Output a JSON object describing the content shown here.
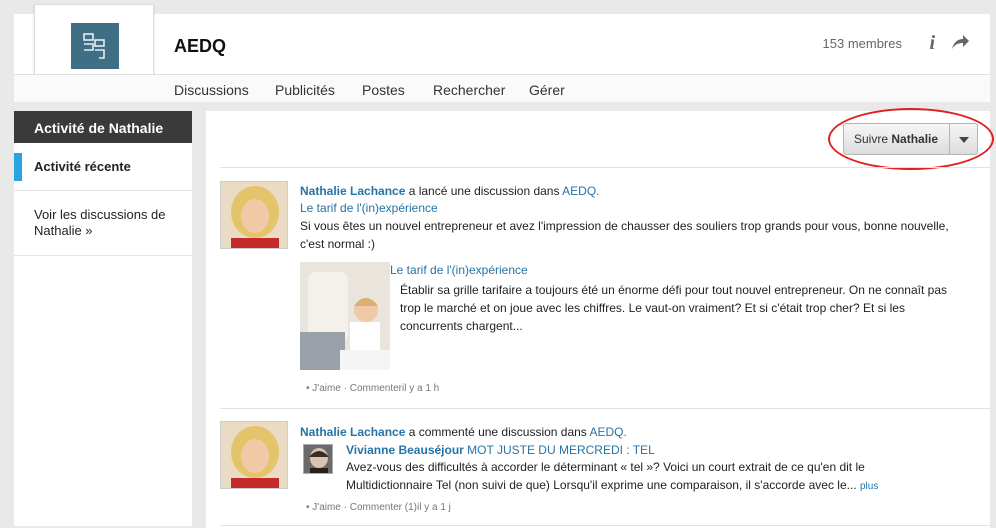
{
  "header": {
    "group_name": "AEDQ",
    "members": "153 membres",
    "info_glyph": "i"
  },
  "nav": {
    "items": [
      "Discussions",
      "Publicités",
      "Postes",
      "Rechercher",
      "Gérer"
    ]
  },
  "sidebar": {
    "title": "Activité de Nathalie",
    "items": [
      "Activité récente",
      "Voir les discussions de Nathalie »"
    ]
  },
  "follow": {
    "label_prefix": "Suivre",
    "label_name": "Nathalie"
  },
  "feed": [
    {
      "author": "Nathalie Lachance",
      "action": " a lancé une discussion dans ",
      "group": "AEDQ.",
      "title": "Le tarif de l'(in)expérience",
      "body": "Si vous êtes un nouvel entrepreneur et avez l'impression de chausser des souliers trop grands pour vous, bonne nouvelle, c'est normal :)",
      "preview_title": "Le tarif de l'(in)expérience",
      "preview_body": "Établir sa grille tarifaire a toujours été un énorme défi pour tout nouvel entrepreneur. On ne connaît pas trop le marché et on joue avec les chiffres. Le vaut-on vraiment? Et si c'était trop cher? Et si les concurrents chargent...",
      "meta_like": "J'aime",
      "meta_comment": "Commenteril y a 1 h"
    },
    {
      "author": "Nathalie Lachance",
      "action": " a commenté une discussion dans ",
      "group": "AEDQ.",
      "sub_author": "Vivianne Beauséjour",
      "sub_title": " MOT JUSTE DU MERCREDI : TEL",
      "body": "Avez-vous des difficultés à accorder le déterminant « tel »? Voici un court extrait de ce qu'en dit le Multidictionnaire Tel (non suivi de que) Lorsqu'il exprime une comparaison, il s'accorde avec le...",
      "more": "plus",
      "meta_like": "J'aime",
      "meta_comment": "Commenter (1)il y a 1 j"
    }
  ]
}
